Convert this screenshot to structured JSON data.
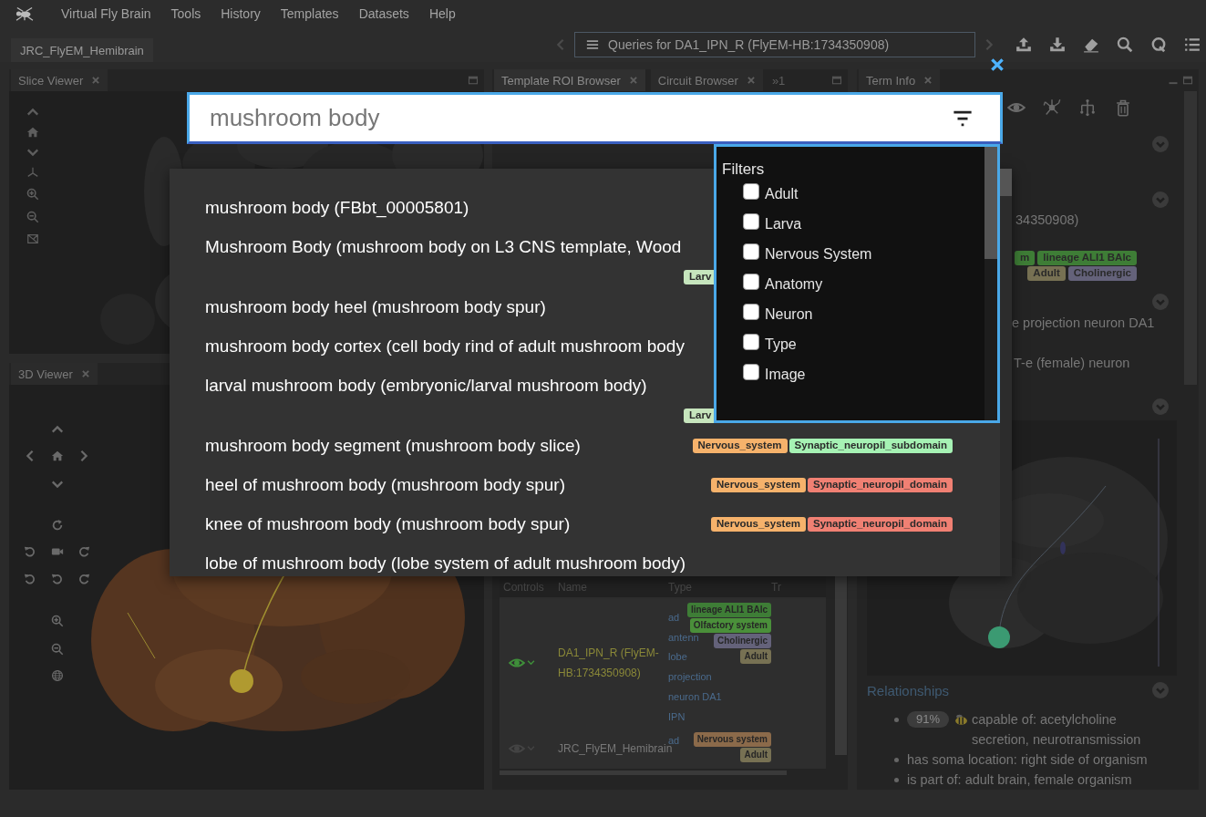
{
  "menu_bar": {
    "title": "Virtual Fly Brain",
    "items": [
      "Tools",
      "History",
      "Templates",
      "Datasets",
      "Help"
    ]
  },
  "toolbar": {
    "template_tab": "JRC_FlyEM_Hemibrain",
    "query_field": "Queries for DA1_IPN_R (FlyEM-HB:1734350908)"
  },
  "slice_viewer": {
    "tab": "Slice Viewer"
  },
  "viewer_3d": {
    "tab": "3D Viewer"
  },
  "browser_panel": {
    "tabs": [
      {
        "label": "Template ROI Browser",
        "selected": true
      },
      {
        "label": "Circuit Browser",
        "selected": false
      }
    ],
    "overflow": "»1",
    "table": {
      "columns": [
        "Controls",
        "Name",
        "Type",
        "Tr"
      ],
      "rows": [
        {
          "visible": true,
          "name": "DA1_IPN_R (FlyEM-HB:1734350908)",
          "type": [
            "ad",
            "antenn",
            "lobe",
            "projection",
            "neuron DA1",
            "IPN"
          ],
          "tags": [
            {
              "label": "lineage ALI1 BAlc",
              "color": "#3e7d36"
            },
            {
              "label": "Olfactory system",
              "color": "#4a8f3a"
            },
            {
              "label": "Cholinergic",
              "color": "#64627a"
            },
            {
              "label": "Adult",
              "color": "#777153"
            }
          ]
        },
        {
          "visible": false,
          "name": "JRC_FlyEM_Hemibrain",
          "type": [
            "ad"
          ],
          "tags": [
            {
              "label": "Nervous system",
              "color": "#8b6a4a"
            },
            {
              "label": "Adult",
              "color": "#777153"
            }
          ]
        }
      ]
    }
  },
  "term_info": {
    "tab": "Term Info",
    "id_fragment": "34350908)",
    "tag_rows": [
      [
        {
          "label": "m",
          "color": "#3e7d36"
        },
        {
          "label": "lineage ALI1 BAlc",
          "color": "#3e7d36"
        }
      ],
      [
        {
          "label": "Adult",
          "color": "#777153"
        },
        {
          "label": "Cholinergic",
          "color": "#64627a"
        }
      ]
    ],
    "lines": [
      "e projection neuron DA1",
      "T-e (female) neuron"
    ],
    "relationships": {
      "title": "Relationships",
      "items": [
        {
          "badge": "91%",
          "text": "capable of: acetylcholine secretion, neurotransmission"
        },
        {
          "text": "has soma location: right side of organism"
        },
        {
          "text": "is part of: adult brain, female organism"
        }
      ]
    }
  },
  "search": {
    "value": "mushroom body",
    "results": [
      {
        "kind": "plain",
        "label": "mushroom body (FBbt_00005801)"
      },
      {
        "kind": "wrapped",
        "label": "Mushroom Body (mushroom body on L3 CNS template, Wood",
        "tags": [
          {
            "label": "Larv",
            "color": "#c6e5bd"
          }
        ]
      },
      {
        "kind": "plain",
        "label": "mushroom body heel (mushroom body spur)"
      },
      {
        "kind": "plain",
        "label": "mushroom body cortex (cell body rind of adult mushroom body"
      },
      {
        "kind": "wrapped",
        "label": "larval mushroom body (embryonic/larval mushroom body)",
        "tags": [
          {
            "label": "Larv",
            "color": "#c6e5bd"
          }
        ]
      },
      {
        "kind": "inline",
        "label": "mushroom body segment (mushroom body slice)",
        "tags": [
          {
            "label": "Nervous_system",
            "color": "#f6b26b"
          },
          {
            "label": "Synaptic_neuropil_subdomain",
            "color": "#a6f2b4"
          }
        ]
      },
      {
        "kind": "inline",
        "label": "heel of mushroom body (mushroom body spur)",
        "tags": [
          {
            "label": "Nervous_system",
            "color": "#f6b26b"
          },
          {
            "label": "Synaptic_neuropil_domain",
            "color": "#f08073"
          }
        ]
      },
      {
        "kind": "inline",
        "label": "knee of mushroom body (mushroom body spur)",
        "tags": [
          {
            "label": "Nervous_system",
            "color": "#f6b26b"
          },
          {
            "label": "Synaptic_neuropil_domain",
            "color": "#f08073"
          }
        ]
      },
      {
        "kind": "plain",
        "label": "lobe of mushroom body (lobe system of adult mushroom body)"
      }
    ],
    "filters": {
      "title": "Filters",
      "options": [
        {
          "label": "Adult",
          "checked": false
        },
        {
          "label": "Larva",
          "checked": false
        },
        {
          "label": "Nervous System",
          "checked": false
        },
        {
          "label": "Anatomy",
          "checked": false
        },
        {
          "label": "Neuron",
          "checked": false
        },
        {
          "label": "Type",
          "checked": false
        },
        {
          "label": "Image",
          "checked": false
        }
      ]
    }
  }
}
